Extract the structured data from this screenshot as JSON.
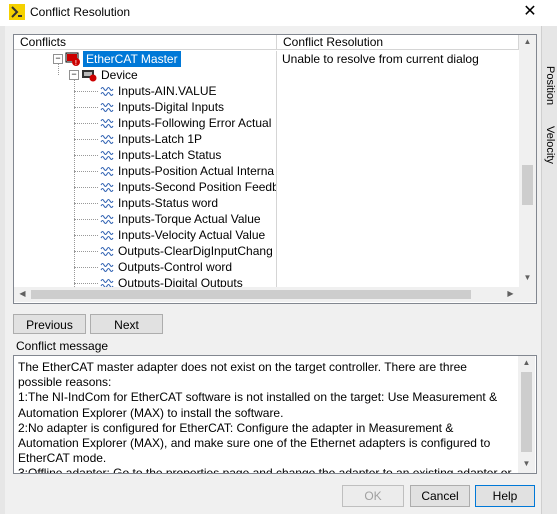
{
  "window": {
    "title": "Conflict Resolution",
    "close_glyph": "✕"
  },
  "background_app": {
    "labels": [
      "Position",
      "Velocity"
    ]
  },
  "table": {
    "headers": [
      "Conflicts",
      "Conflict Resolution"
    ],
    "resolution_text": "Unable to resolve from current dialog",
    "master_label": "EtherCAT Master",
    "device_label": "Device",
    "items": [
      "Inputs-AIN.VALUE",
      "Inputs-Digital Inputs",
      "Inputs-Following Error Actual",
      "Inputs-Latch 1P",
      "Inputs-Latch Status",
      "Inputs-Position Actual Interna",
      "Inputs-Second Position Feedb",
      "Inputs-Status word",
      "Inputs-Torque Actual Value",
      "Inputs-Velocity Actual Value",
      "Outputs-ClearDigInputChang",
      "Outputs-Control word",
      "Outputs-Digital Outputs"
    ]
  },
  "nav": {
    "previous_label": "Previous",
    "next_label": "Next"
  },
  "message": {
    "label": "Conflict message",
    "text": "The EtherCAT master adapter does not exist on the target controller. There are three possible reasons:\n1:The NI-IndCom for EtherCAT software is not installed on the target: Use Measurement & Automation Explorer (MAX) to install the software.\n2:No adapter is configured for EtherCAT: Configure the adapter in Measurement & Automation Explorer (MAX), and make sure one of the Ethernet adapters is configured to EtherCAT mode.\n3:Offline adapter: Go to the properties page and change the adapter to an existing adapter or"
  },
  "footer": {
    "ok_label": "OK",
    "cancel_label": "Cancel",
    "help_label": "Help"
  },
  "colors": {
    "selection": "#0078d7",
    "accent_border": "#0078d7"
  }
}
